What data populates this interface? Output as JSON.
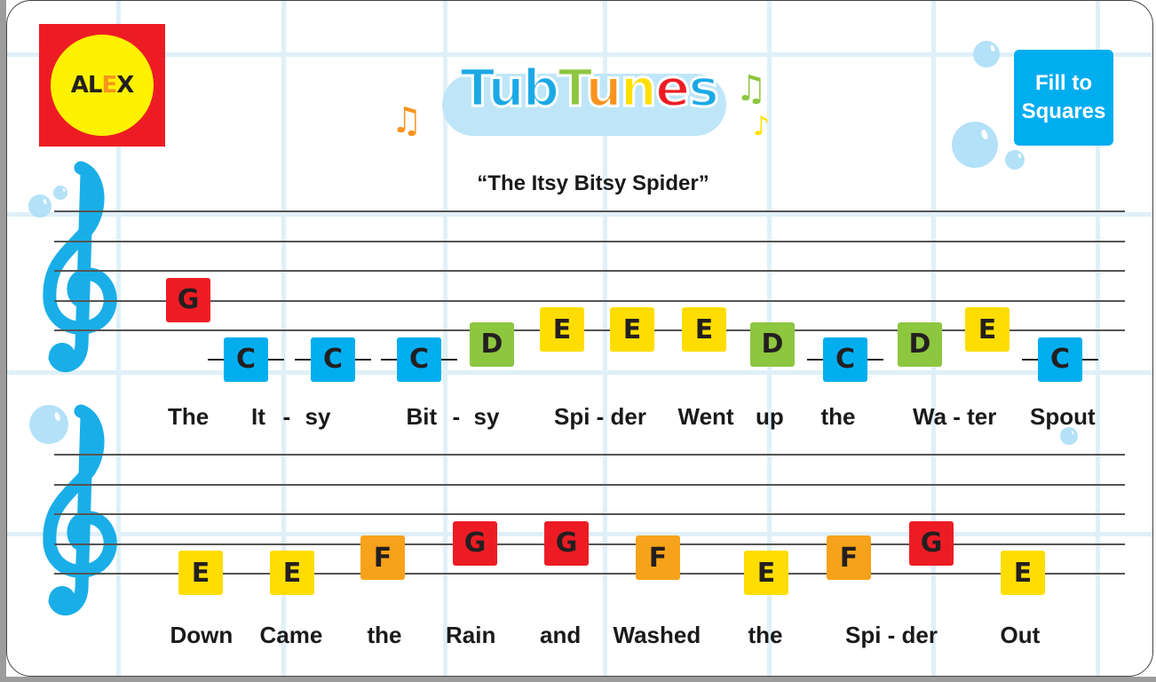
{
  "brand": {
    "logo_text_left": "AL",
    "logo_text_e": "E",
    "logo_text_right": "X",
    "product_name": [
      "T",
      "u",
      "b",
      "T",
      "u",
      "n",
      "e",
      "s"
    ],
    "product_letter_colors": [
      "#1ba9e6",
      "#1ba9e6",
      "#1ba9e6",
      "#8dc63f",
      "#f7941d",
      "#ffe000",
      "#ed1c24",
      "#1ba9e6"
    ]
  },
  "song": {
    "title": "“The Itsy Bitsy Spider”"
  },
  "fill_button": {
    "line1": "Fill to",
    "line2": "Squares"
  },
  "note_colors": {
    "C": "#00aeef",
    "D": "#8dc63f",
    "E": "#ffdd00",
    "F": "#f7a21b",
    "G": "#ed1c24"
  },
  "staves": [
    {
      "notes": [
        "G",
        "C",
        "C",
        "C",
        "D",
        "E",
        "E",
        "E",
        "D",
        "C",
        "D",
        "E",
        "C"
      ],
      "lyrics": [
        "The",
        "It",
        "-",
        "sy",
        "Bit",
        "-",
        "sy",
        "Spi - der",
        "Went",
        "up",
        "the",
        "Wa - ter",
        "Spout"
      ]
    },
    {
      "notes": [
        "E",
        "E",
        "F",
        "G",
        "G",
        "F",
        "E",
        "F",
        "G",
        "E"
      ],
      "lyrics": [
        "Down",
        "Came",
        "the",
        "Rain",
        "and",
        "Washed",
        "the",
        "Spi - der",
        "Out"
      ]
    }
  ],
  "icons": {
    "treble_clef": "treble-clef-icon",
    "music_note": "music-note-icon",
    "bubble": "bubble-icon"
  }
}
